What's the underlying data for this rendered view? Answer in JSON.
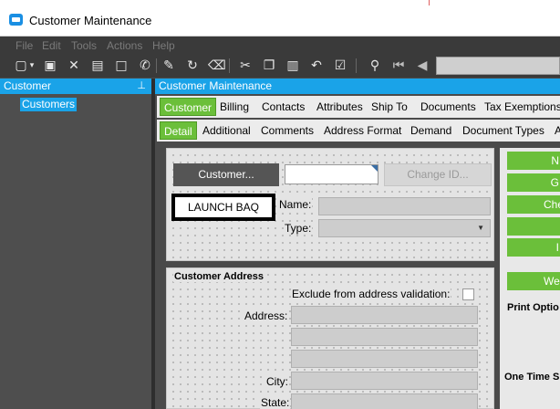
{
  "window": {
    "title": "Customer Maintenance"
  },
  "menu": [
    "File",
    "Edit",
    "Tools",
    "Actions",
    "Help"
  ],
  "toolbar_icons": [
    "new-icon",
    "dropdown-icon",
    "save-icon",
    "delete-icon",
    "book-icon",
    "square-icon",
    "phone-icon",
    "attach-icon",
    "refresh-icon",
    "clear-icon",
    "cut-icon",
    "copy-icon",
    "paste-icon",
    "undo-icon",
    "clipboard-icon",
    "binoculars-icon",
    "first-record-icon",
    "prev-record-icon"
  ],
  "left_panel": {
    "header": "Customer",
    "tree_items": [
      "Customers"
    ]
  },
  "right_panel": {
    "header": "Customer Maintenance"
  },
  "tabs_primary": [
    "Customer",
    "Billing",
    "Contacts",
    "Attributes",
    "Ship To",
    "Documents",
    "Tax Exemptions"
  ],
  "tabs_secondary": [
    "Detail",
    "Additional",
    "Comments",
    "Address Format",
    "Demand",
    "Document Types",
    "A"
  ],
  "form": {
    "customer_button": "Customer...",
    "customer_id_value": "",
    "change_id_button": "Change ID...",
    "launch_baq": "LAUNCH BAQ",
    "name_label": "Name:",
    "type_label": "Type:"
  },
  "address": {
    "title": "Customer Address",
    "exclude_label": "Exclude from address validation:",
    "address_label": "Address:",
    "city_label": "City:",
    "state_label": "State:"
  },
  "side": {
    "buttons": [
      "N",
      "G",
      "Che",
      "",
      "I"
    ],
    "web_button": "We",
    "print_title": "Print Optio",
    "one_time_title": "One Time S"
  },
  "colors": {
    "accent_blue": "#1aa3e8",
    "tab_green": "#6bbf3a",
    "dark_bg": "#3a3a3a"
  }
}
